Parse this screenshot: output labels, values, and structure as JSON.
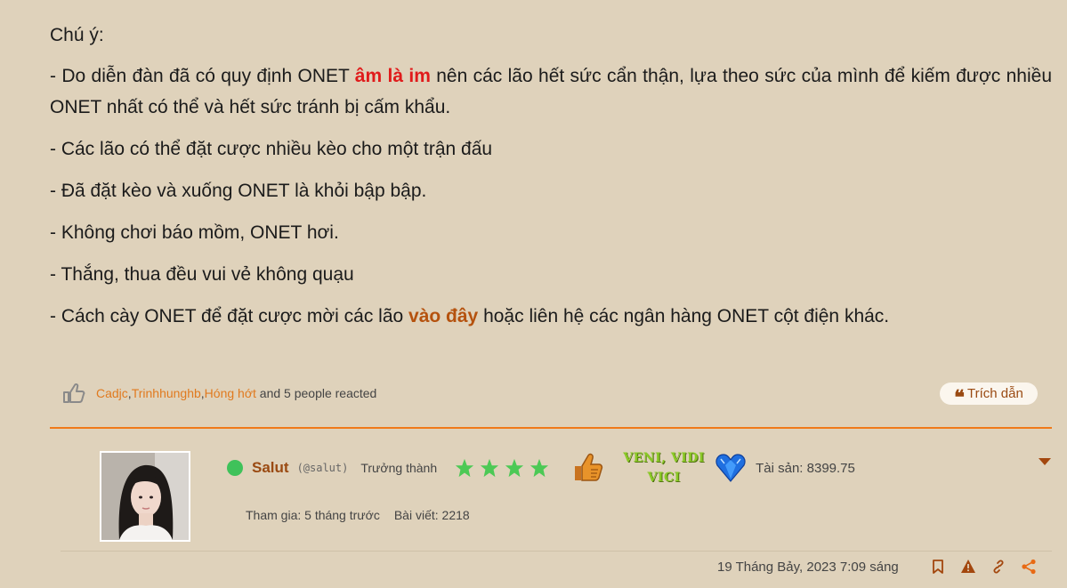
{
  "post": {
    "heading": "Chú ý:",
    "rule1_pre": "- Do diễn đàn đã có quy định ONET ",
    "rule1_em": "âm là im",
    "rule1_post": " nên các lão hết sức cẩn thận, lựa theo sức của mình để kiếm được nhiều ONET nhất có thể và hết sức tránh bị cấm khẩu.",
    "rule2": "- Các lão có thể đặt cược nhiều kèo cho một trận đấu",
    "rule3": "- Đã đặt kèo và xuống ONET là khỏi bập bập.",
    "rule4": "- Không chơi báo mồm, ONET hơi.",
    "rule5": "- Thắng, thua đều vui vẻ không quạu",
    "rule6_pre": "- Cách cày ONET để đặt cược mời các lão ",
    "rule6_link": "vào đây",
    "rule6_post": " hoặc liên hệ các ngân hàng ONET cột điện khác."
  },
  "reactions": {
    "users": [
      "Cadjc",
      "Trinhhunghb",
      "Hóng hớt"
    ],
    "sep": ", ",
    "suffix": " and 5 people reacted"
  },
  "quote_button": {
    "label": "Trích dẫn",
    "icon": "quote-icon"
  },
  "user": {
    "name": "Salut",
    "handle": "(@salut)",
    "rank": "Trưởng thành",
    "stars": 4,
    "trophy_line1": "VENI, VIDI",
    "trophy_line2": "VICI",
    "assets": "Tài sản: 8399.75",
    "joined": "Tham gia: 5 tháng trước",
    "posts": "Bài viết: 2218"
  },
  "footer": {
    "date": "19 Tháng Bảy, 2023 7:09 sáng",
    "icons": [
      "bookmark-icon",
      "report-icon",
      "link-icon",
      "share-icon"
    ]
  },
  "colors": {
    "background": "#dfd2bb",
    "accent": "#f07a1a",
    "link": "#e07a1f",
    "alert": "#e01b1b"
  }
}
